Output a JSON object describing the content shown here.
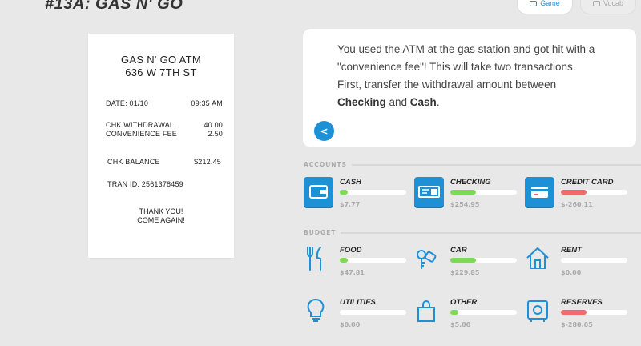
{
  "header": {
    "title": "#13A: GAS N' GO",
    "tabs": [
      {
        "label": "Game"
      },
      {
        "label": "Vocab"
      }
    ]
  },
  "receipt": {
    "line1": "GAS N' GO ATM",
    "line2": "636 W 7TH ST",
    "date_label": "DATE: 01/10",
    "time": "09:35 AM",
    "withdrawal_label": "CHK WITHDRAWAL",
    "withdrawal_amount": "40.00",
    "fee_label": "CONVENIENCE FEE",
    "fee_amount": "2.50",
    "balance_label": "CHK BALANCE",
    "balance_amount": "$212.45",
    "tran_id": "TRAN ID: 2561378459",
    "thanks1": "THANK YOU!",
    "thanks2": "COME AGAIN!"
  },
  "message": {
    "line1": "You used the ATM at the gas station and got hit with a",
    "line2": "\"convenience fee\"! This will take two transactions.",
    "line3": "First, transfer the withdrawal amount between",
    "bold1": "Checking",
    "and": " and ",
    "bold2": "Cash",
    "end": ".",
    "back_label": "<"
  },
  "accounts": {
    "section_label": "ACCOUNTS",
    "items": [
      {
        "name": "CASH",
        "amount": "$7.77",
        "fill": 0.12,
        "color": "#7ed957",
        "icon": "wallet-icon"
      },
      {
        "name": "CHECKING",
        "amount": "$254.95",
        "fill": 0.38,
        "color": "#7ed957",
        "icon": "check-icon"
      },
      {
        "name": "CREDIT CARD",
        "amount": "$-260.11",
        "fill": 0.38,
        "color": "#f26b6b",
        "icon": "credit-card-icon"
      }
    ]
  },
  "budget": {
    "section_label": "BUDGET",
    "items": [
      {
        "name": "FOOD",
        "amount": "$47.81",
        "fill": 0.12,
        "color": "#7ed957",
        "icon": "fork-knife-icon"
      },
      {
        "name": "CAR",
        "amount": "$229.85",
        "fill": 0.38,
        "color": "#7ed957",
        "icon": "car-key-icon"
      },
      {
        "name": "RENT",
        "amount": "$0.00",
        "fill": 0,
        "color": "#7ed957",
        "icon": "house-icon"
      },
      {
        "name": "UTILITIES",
        "amount": "$0.00",
        "fill": 0,
        "color": "#7ed957",
        "icon": "lightbulb-icon"
      },
      {
        "name": "OTHER",
        "amount": "$5.00",
        "fill": 0.12,
        "color": "#7ed957",
        "icon": "shopping-bag-icon"
      },
      {
        "name": "RESERVES",
        "amount": "$-280.05",
        "fill": 0.38,
        "color": "#f26b6b",
        "icon": "safe-icon"
      }
    ]
  },
  "colors": {
    "accent": "#1e90d6",
    "positive": "#7ed957",
    "negative": "#f26b6b"
  }
}
